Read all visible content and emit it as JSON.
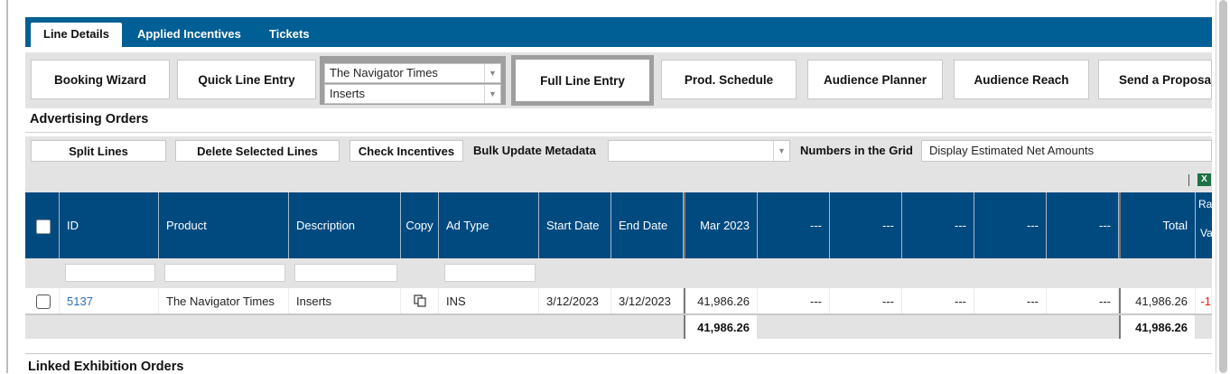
{
  "tabs": [
    "Line Details",
    "Applied Incentives",
    "Tickets"
  ],
  "toolbar": {
    "booking_wizard": "Booking Wizard",
    "quick_line_entry": "Quick Line Entry",
    "publication_select": "The Navigator Times",
    "adtype_select": "Inserts",
    "full_line_entry": "Full Line Entry",
    "prod_schedule": "Prod. Schedule",
    "audience_planner": "Audience Planner",
    "audience_reach": "Audience Reach",
    "send_proposal": "Send a Proposal"
  },
  "section_title": "Advertising Orders",
  "actions": {
    "split_lines": "Split Lines",
    "delete_selected": "Delete Selected Lines",
    "check_incentives": "Check Incentives",
    "bulk_update_label": "Bulk Update Metadata",
    "bulk_update_value": "",
    "numbers_label": "Numbers in the Grid",
    "numbers_value": "Display Estimated Net Amounts"
  },
  "grid": {
    "headers": {
      "id": "ID",
      "product": "Product",
      "description": "Description",
      "copy": "Copy",
      "ad_type": "Ad Type",
      "start_date": "Start Date",
      "end_date": "End Date",
      "m1": "Mar 2023",
      "m2": "---",
      "m3": "---",
      "m4": "---",
      "m5": "---",
      "m6": "---",
      "total": "Total",
      "rate_top": "Ra",
      "rate_bottom": "Va"
    },
    "rows": [
      {
        "id": "5137",
        "product": "The Navigator Times",
        "description": "Inserts",
        "ad_type": "INS",
        "start_date": "3/12/2023",
        "end_date": "3/12/2023",
        "m1": "41,986.26",
        "m2": "---",
        "m3": "---",
        "m4": "---",
        "m5": "---",
        "m6": "---",
        "total": "41,986.26",
        "rate": "-1"
      }
    ],
    "totals": {
      "m1": "41,986.26",
      "total": "41,986.26"
    }
  },
  "section2_title": "Linked Exhibition Orders",
  "icons": {
    "excel": "excel-export-icon",
    "copy": "copy-icon",
    "dropdown": "chevron-down-icon"
  },
  "colors": {
    "tab_bar": "#005f94",
    "grid_header": "#004a80",
    "link": "#2a6fb8",
    "negative": "#dd2211",
    "excel": "#1e7145"
  }
}
